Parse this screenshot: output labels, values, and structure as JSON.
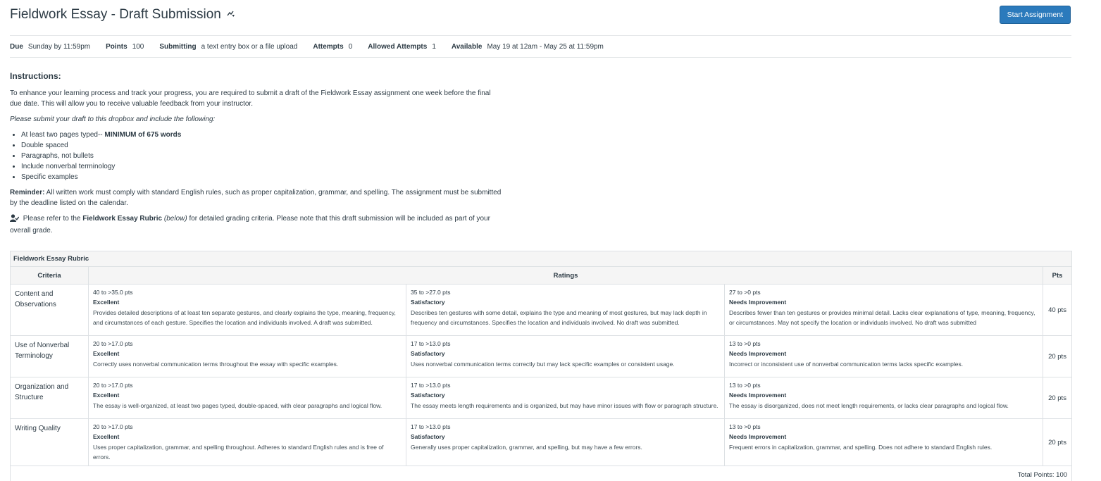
{
  "header": {
    "title": "Fieldwork Essay - Draft Submission",
    "start_button": "Start Assignment"
  },
  "meta": {
    "due_label": "Due",
    "due_value": "Sunday by 11:59pm",
    "points_label": "Points",
    "points_value": "100",
    "submitting_label": "Submitting",
    "submitting_value": "a text entry box or a file upload",
    "attempts_label": "Attempts",
    "attempts_value": "0",
    "allowed_label": "Allowed Attempts",
    "allowed_value": "1",
    "available_label": "Available",
    "available_value": "May 19 at 12am - May 25 at 11:59pm"
  },
  "instructions": {
    "heading": "Instructions:",
    "intro": "To enhance your learning process and track your progress, you are required to submit a draft of the Fieldwork Essay assignment one week before the final due date. This will allow you to receive valuable feedback from your instructor.",
    "please": "Please submit your draft to this dropbox and include the following:",
    "bullet1_prefix": "At least two pages typed-- ",
    "bullet1_bold": "MINIMUM of 675 words",
    "bullet2": "Double spaced",
    "bullet3": "Paragraphs, not bullets",
    "bullet4": "Include nonverbal terminology",
    "bullet5": "Specific examples",
    "reminder_label": "Reminder:",
    "reminder_text": " All written work must comply with standard English rules, such as proper capitalization, grammar, and spelling. The assignment must be submitted by the deadline listed on the calendar.",
    "refer_prefix": " Please refer to the ",
    "refer_bold": "Fieldwork Essay Rubric",
    "refer_italic": " (below)",
    "refer_suffix": " for detailed grading criteria. Please note that this draft submission will be included as part of your overall grade."
  },
  "rubric": {
    "title": "Fieldwork Essay Rubric",
    "col_criteria": "Criteria",
    "col_ratings": "Ratings",
    "col_pts": "Pts",
    "rows": [
      {
        "criteria": "Content and Observations",
        "ratings": [
          {
            "pts": "40 to >35.0 pts",
            "level": "Excellent",
            "desc": "Provides detailed descriptions of at least ten separate gestures, and clearly explains the type, meaning, frequency, and circumstances of each gesture. Specifies the location and individuals involved. A draft was submitted."
          },
          {
            "pts": "35 to >27.0 pts",
            "level": "Satisfactory",
            "desc": "Describes ten gestures with some detail, explains the type and meaning of most gestures, but may lack depth in frequency and circumstances. Specifies the location and individuals involved. No draft was submitted."
          },
          {
            "pts": "27 to >0 pts",
            "level": "Needs Improvement",
            "desc": "Describes fewer than ten gestures or provides minimal detail. Lacks clear explanations of type, meaning, frequency, or circumstances. May not specify the location or individuals involved. No draft was submitted"
          }
        ],
        "points": "40 pts"
      },
      {
        "criteria": "Use of Nonverbal Terminology",
        "ratings": [
          {
            "pts": "20 to >17.0 pts",
            "level": "Excellent",
            "desc": "Correctly uses nonverbal communication terms throughout the essay with specific examples."
          },
          {
            "pts": "17 to >13.0 pts",
            "level": "Satisfactory",
            "desc": "Uses nonverbal communication terms correctly but may lack specific examples or consistent usage."
          },
          {
            "pts": "13 to >0 pts",
            "level": "Needs Improvement",
            "desc": "Incorrect or inconsistent use of nonverbal communication terms lacks specific examples."
          }
        ],
        "points": "20 pts"
      },
      {
        "criteria": "Organization and Structure",
        "ratings": [
          {
            "pts": "20 to >17.0 pts",
            "level": "Excellent",
            "desc": "The essay is well-organized, at least two pages typed, double-spaced, with clear paragraphs and logical flow."
          },
          {
            "pts": "17 to >13.0 pts",
            "level": "Satisfactory",
            "desc": "The essay meets length requirements and is organized, but may have minor issues with flow or paragraph structure."
          },
          {
            "pts": "13 to >0 pts",
            "level": "Needs Improvement",
            "desc": "The essay is disorganized, does not meet length requirements, or lacks clear paragraphs and logical flow."
          }
        ],
        "points": "20 pts"
      },
      {
        "criteria": "Writing Quality",
        "ratings": [
          {
            "pts": "20 to >17.0 pts",
            "level": "Excellent",
            "desc": "Uses proper capitalization, grammar, and spelling throughout. Adheres to standard English rules and is free of errors."
          },
          {
            "pts": "17 to >13.0 pts",
            "level": "Satisfactory",
            "desc": "Generally uses proper capitalization, grammar, and spelling, but may have a few errors."
          },
          {
            "pts": "13 to >0 pts",
            "level": "Needs Improvement",
            "desc": "Frequent errors in capitalization, grammar, and spelling. Does not adhere to standard English rules."
          }
        ],
        "points": "20 pts"
      }
    ],
    "total": "Total Points: 100"
  },
  "colors": {
    "accent": "#2b7abc",
    "text": "#2d3b45",
    "border": "#dde1e4",
    "header_bg": "#f5f5f5"
  },
  "icons": {
    "publish": "publish-toggle-icon",
    "refer": "user-check-icon"
  }
}
